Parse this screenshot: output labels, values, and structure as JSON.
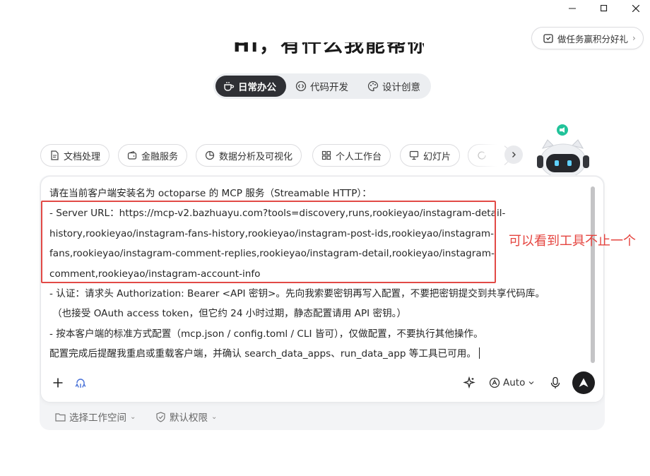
{
  "window": {
    "controls": [
      "minimize-icon",
      "maximize-icon",
      "close-icon"
    ]
  },
  "reward": {
    "label": "做任务赢积分好礼",
    "icon": "gift-icon",
    "chevron": "›"
  },
  "heading": {
    "partial": "Hi，有什么我能帮你"
  },
  "modes": {
    "items": [
      {
        "label": "日常办公",
        "icon": "cup-icon",
        "active": true
      },
      {
        "label": "代码开发",
        "icon": "code-icon",
        "active": false
      },
      {
        "label": "设计创意",
        "icon": "palette-icon",
        "active": false
      }
    ]
  },
  "skills": {
    "items": [
      {
        "label": "文档处理",
        "icon": "document-icon"
      },
      {
        "label": "金融服务",
        "icon": "wallet-icon"
      },
      {
        "label": "数据分析及可视化",
        "icon": "pie-chart-icon"
      },
      {
        "label": "个人工作台",
        "icon": "grid-icon"
      },
      {
        "label": "幻灯片",
        "icon": "presentation-icon"
      }
    ]
  },
  "prompt": {
    "lines": [
      "请在当前客户端安装名为 octoparse 的 MCP 服务（Streamable HTTP）：",
      "- Server URL：https://mcp-v2.bazhuayu.com?tools=discovery,runs,rookieyao/instagram-detail-",
      "history,rookieyao/instagram-fans-history,rookieyao/instagram-post-ids,rookieyao/instagram-",
      "fans,rookieyao/instagram-comment-replies,rookieyao/instagram-detail,rookieyao/instagram-",
      "comment,rookieyao/instagram-account-info",
      "- 认证：请求头 Authorization: Bearer <API 密钥>。先向我索要密钥再写入配置，不要把密钥提交到共享代码库。",
      "（也接受 OAuth access token，但它约 24 小时过期，静态配置请用 API 密钥。）",
      "- 按本客户端的标准方式配置（mcp.json / config.toml / CLI 皆可），仅做配置，不要执行其他操作。",
      "配置完成后提醒我重启或重载客户端，并确认 search_data_apps、run_data_app 等工具已可用。"
    ]
  },
  "annotation": {
    "text": "可以看到工具不止一个",
    "color": "#e5443f"
  },
  "toolbar": {
    "model": "Auto"
  },
  "footer": {
    "workspace": "选择工作空间",
    "permission": "默认权限"
  },
  "colors": {
    "accent_dark": "#2f3035",
    "highlight_red": "#e24a46",
    "mascot_green": "#22c39a"
  }
}
